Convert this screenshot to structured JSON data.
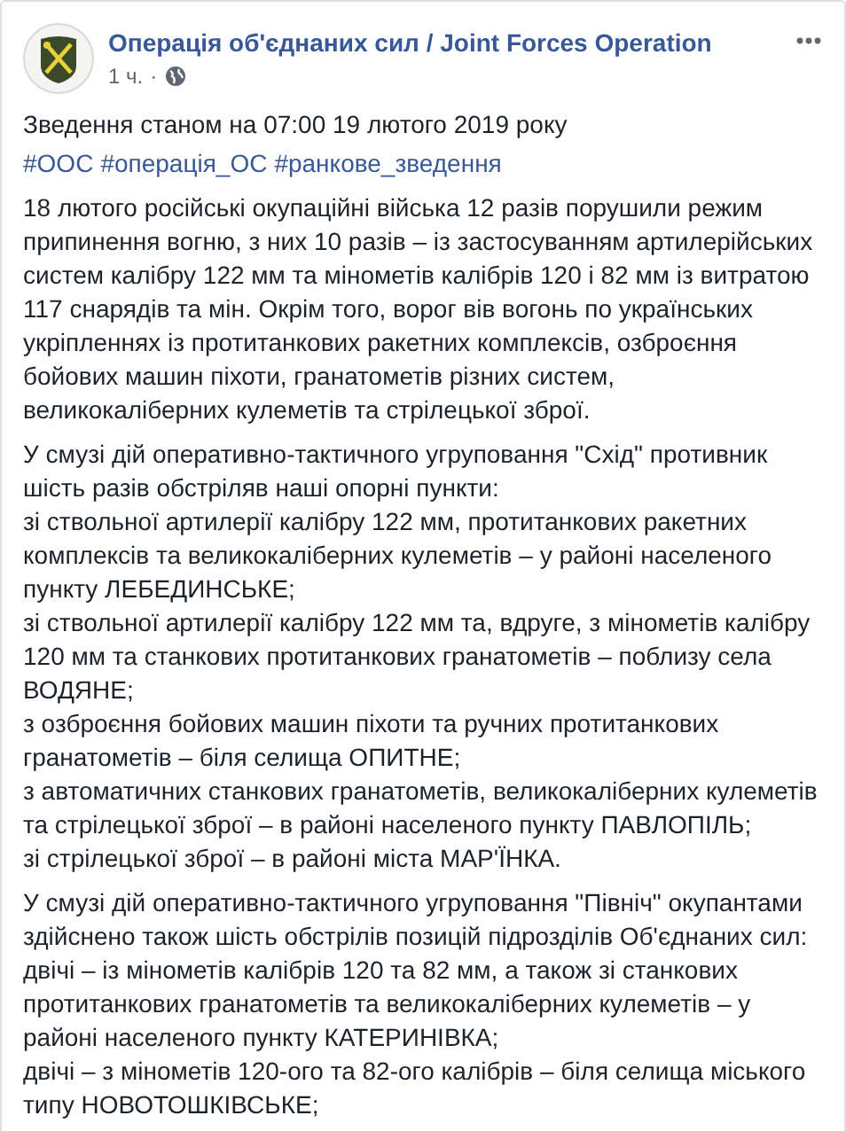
{
  "post": {
    "author": "Операція об'єднаних сил / Joint Forces Operation",
    "time": "1 ч.",
    "separator": "·",
    "heading": "Зведення станом на 07:00 19 лютого 2019 року",
    "hashtags": [
      "#ООС",
      "#операція_ОС",
      "#ранкове_зведення"
    ],
    "paragraphs": [
      "18 лютого російські окупаційні війська 12 разів порушили режим припинення вогню, з них 10 разів – із застосуванням артилерійських систем калібру 122 мм та мінометів калібрів 120 і 82 мм із витратою 117 снарядів та мін. Окрім того, ворог вів вогонь по українських укріпленнях із протитанкових ракетних комплексів, озброєння бойових машин піхоти, гранатометів різних систем, великокаліберних кулеметів та стрілецької зброї.",
      "У смузі дій оперативно-тактичного угруповання \"Схід\" противник шість разів обстріляв наші опорні пункти:\nзі ствольної артилерії калібру 122 мм, протитанкових ракетних комплексів та великокаліберних кулеметів – у районі населеного пункту ЛЕБЕДИНСЬКЕ;\nзі ствольної артилерії калібру 122 мм та, вдруге, з мінометів калібру 120 мм та станкових протитанкових гранатометів – поблизу села ВОДЯНЕ;\nз озброєння бойових машин піхоти та ручних протитанкових гранатометів – біля селища ОПИТНЕ;\nз автоматичних станкових гранатометів, великокаліберних кулеметів та стрілецької зброї – в районі населеного пункту ПАВЛОПІЛЬ;\nзі стрілецької зброї – в районі міста МАР'ЇНКА.",
      "У смузі дій оперативно-тактичного угруповання \"Північ\" окупантами здійснено також шість обстрілів позицій підрозділів Об'єднаних сил:\nдвічі – із мінометів калібрів 120 та 82 мм, а також зі станкових протитанкових гранатометів та великокаліберних кулеметів – у районі населеного пункту КАТЕРИНІВКА;\nдвічі – з мінометів 120-ого та 82-ого калібрів – біля селища міського типу НОВОТОШКІВСЬКЕ;"
    ]
  }
}
